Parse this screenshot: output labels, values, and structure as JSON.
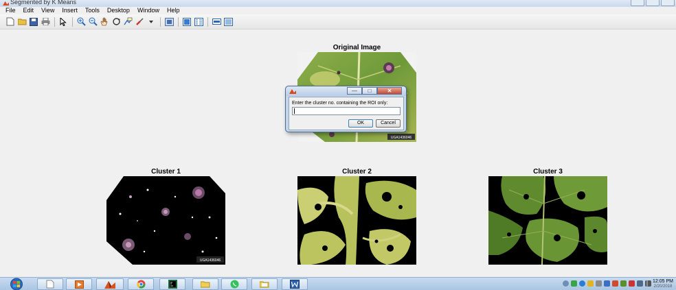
{
  "window": {
    "title": "Segmented by K Means"
  },
  "menubar": {
    "items": [
      "File",
      "Edit",
      "View",
      "Insert",
      "Tools",
      "Desktop",
      "Window",
      "Help"
    ]
  },
  "toolbar": {
    "icons": [
      "new-figure-icon",
      "open-file-icon",
      "save-figure-icon",
      "print-figure-icon",
      "edit-plot-icon",
      "zoom-in-icon",
      "zoom-out-icon",
      "pan-icon",
      "rotate-3d-icon",
      "data-cursor-icon",
      "brush-icon",
      "link-plot-icon",
      "insert-colorbar-icon",
      "insert-legend-icon",
      "hide-plot-tools-icon",
      "show-plot-tools-icon"
    ]
  },
  "figure": {
    "original_title": "Original Image",
    "cluster1_title": "Cluster 1",
    "cluster2_title": "Cluster 2",
    "cluster3_title": "Cluster 3",
    "watermark": "UGA1436046"
  },
  "dialog": {
    "prompt": "Enter the cluster no. containing the ROI only:",
    "input_value": "",
    "ok_label": "OK",
    "cancel_label": "Cancel"
  },
  "taskbar": {
    "apps": [
      "explorer",
      "media-player",
      "matlab",
      "chrome",
      "pycharm",
      "folder",
      "whatsapp",
      "files",
      "word"
    ],
    "time": "12:05 PM",
    "date": "2/20/2018"
  },
  "colors": {
    "leaf_green": "#6f9a3a",
    "leaf_yellow": "#c9cf72",
    "lesion_purple": "#5b3a55",
    "taskbar_blue": "#b8d0ea"
  }
}
